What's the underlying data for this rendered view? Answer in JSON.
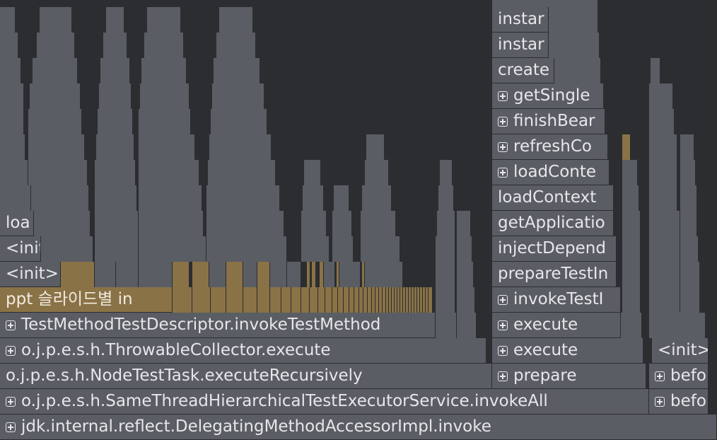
{
  "flame": {
    "rows": [
      {
        "label": "jdk.internal.reflect.DelegatingMethodAccessorImpl.invoke",
        "expandable": true
      },
      {
        "label": "o.j.p.e.s.h.SameThreadHierarchicalTestExecutorService.invokeAll",
        "expandable": true
      },
      {
        "label": "o.j.p.e.s.h.NodeTestTask.executeRecursively",
        "expandable": false
      },
      {
        "label": "o.j.p.e.s.h.ThrowableCollector.execute",
        "expandable": true
      },
      {
        "label": "TestMethodTestDescriptor.invokeTestMethod",
        "expandable": true
      },
      {
        "label": "ppt 슬라이드별 in",
        "expandable": false,
        "highlighted": true
      },
      {
        "label": "<init>",
        "expandable": false
      },
      {
        "label": "<init",
        "expandable": false
      },
      {
        "label": "loa",
        "expandable": false
      }
    ],
    "middle_column": [
      {
        "label": "instar",
        "expandable": false
      },
      {
        "label": "instar",
        "expandable": false
      },
      {
        "label": "create",
        "expandable": false
      },
      {
        "label": "getSingle",
        "expandable": true
      },
      {
        "label": "finishBear",
        "expandable": true
      },
      {
        "label": "refreshCo",
        "expandable": true
      },
      {
        "label": "loadConte",
        "expandable": true
      },
      {
        "label": "loadContext",
        "expandable": false
      },
      {
        "label": "getApplicatio",
        "expandable": false
      },
      {
        "label": "injectDepend",
        "expandable": false
      },
      {
        "label": "prepareTestIn",
        "expandable": false
      },
      {
        "label": "invokeTestI",
        "expandable": true
      },
      {
        "label": "execute",
        "expandable": true
      },
      {
        "label": "execute",
        "expandable": true
      },
      {
        "label": "prepare",
        "expandable": true
      }
    ],
    "right_column": [
      {
        "label": "<init>",
        "expandable": false
      },
      {
        "label": "befo",
        "expandable": true
      },
      {
        "label": "befo",
        "expandable": true
      }
    ],
    "colors": {
      "background": "#2b2d30",
      "frame": "#5a5d63",
      "highlight": "#8a7247",
      "text": "#e6e7ea"
    }
  }
}
